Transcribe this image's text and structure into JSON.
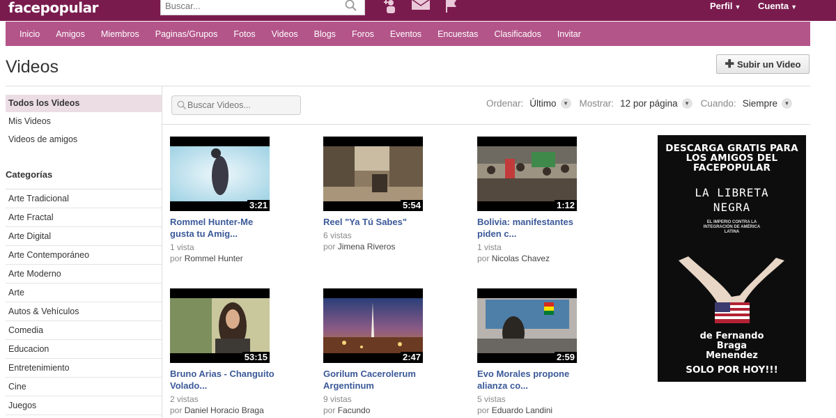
{
  "header": {
    "logo": "facepopular",
    "search_placeholder": "Buscar...",
    "icons": [
      "add-friend-icon",
      "mail-icon",
      "flag-icon"
    ],
    "profile_label": "Perfil",
    "account_label": "Cuenta"
  },
  "nav": {
    "items": [
      "Inicio",
      "Amigos",
      "Miembros",
      "Paginas/Grupos",
      "Fotos",
      "Videos",
      "Blogs",
      "Foros",
      "Eventos",
      "Encuestas",
      "Clasificados",
      "Invitar"
    ]
  },
  "page": {
    "title": "Videos",
    "upload_label": "Subir un Video"
  },
  "sidebar": {
    "links": [
      "Todos los Videos",
      "Mis Videos",
      "Videos de amigos"
    ],
    "active": "Todos los Videos",
    "categories_heading": "Categorías",
    "categories": [
      "Arte Tradicional",
      "Arte Fractal",
      "Arte Digital",
      "Arte Contemporáneo",
      "Arte Moderno",
      "Arte",
      "Autos & Vehículos",
      "Comedia",
      "Educacion",
      "Entretenimiento",
      "Cine",
      "Juegos"
    ]
  },
  "filters": {
    "search_placeholder": "Buscar Videos...",
    "order_label": "Ordenar:",
    "order_value": "Último",
    "show_label": "Mostrar:",
    "show_value": "12 por página",
    "when_label": "Cuando:",
    "when_value": "Siempre"
  },
  "videos": [
    {
      "duration": "3:21",
      "title": "Rommel Hunter-Me gusta tu Amig...",
      "views": "1 vista",
      "by_label": "por",
      "author": "Rommel Hunter"
    },
    {
      "duration": "5:54",
      "title": "Reel \"Ya Tú Sabes\"",
      "views": "6 vistas",
      "by_label": "por",
      "author": "Jimena Riveros"
    },
    {
      "duration": "1:12",
      "title": "Bolivia: manifestantes piden c...",
      "views": "1 vista",
      "by_label": "por",
      "author": "Nicolas Chavez"
    },
    {
      "duration": "53:15",
      "title": "Bruno Arias - Changuito Volado...",
      "views": "2 vistas",
      "by_label": "por",
      "author": "Daniel Horacio Braga"
    },
    {
      "duration": "2:47",
      "title": "Gorilum Cacerolerum Argentinum",
      "views": "9 vistas",
      "by_label": "por",
      "author": "Facundo"
    },
    {
      "duration": "2:59",
      "title": "Evo Morales propone alianza co...",
      "views": "5 vistas",
      "by_label": "por",
      "author": "Eduardo Landini"
    }
  ],
  "ad": {
    "headline": "DESCARGA GRATIS PARA LOS AMIGOS DEL FACEPOPULAR",
    "book_title": "LA LIBRETA NEGRA",
    "book_subtitle": "EL IMPERIO CONTRA LA INTEGRACIÓN DE AMÉRICA LATINA",
    "author_line": "de Fernando Braga Menendez",
    "cta": "SOLO POR HOY!!!"
  },
  "colors": {
    "topbar": "#7a1b4e",
    "navbar": "#b4558a",
    "link": "#3b5998",
    "active_bg": "#ecdde5"
  }
}
